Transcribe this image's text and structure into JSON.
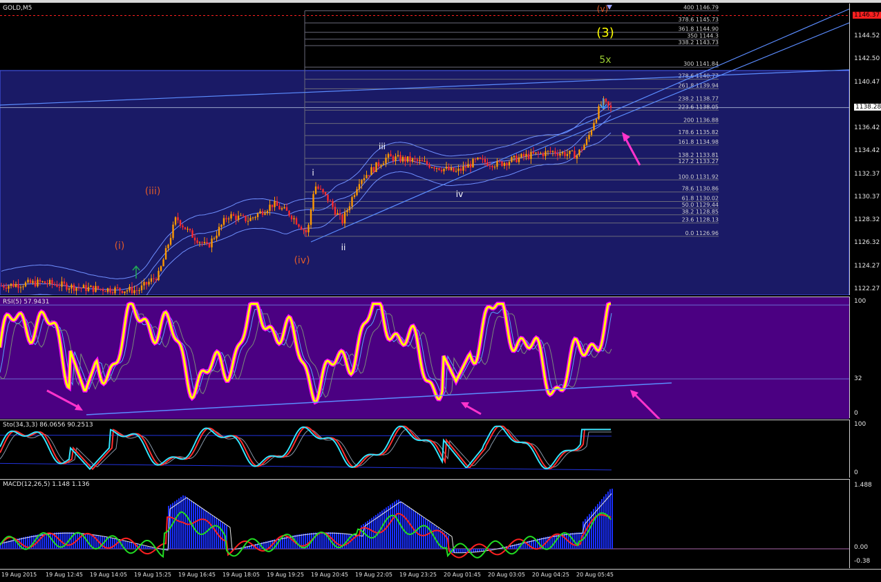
{
  "chart_title": "GOLD,M5",
  "price_axis": {
    "labels": [
      "1146.37",
      "1144.52",
      "1142.50",
      "1140.47",
      "1138.28",
      "1136.42",
      "1134.42",
      "1132.37",
      "1130.37",
      "1128.32",
      "1126.32",
      "1124.27",
      "1122.27"
    ],
    "current_price": "1138.28",
    "alert_price": "1146.37"
  },
  "fibonacci_levels": [
    {
      "label": "400 1146.79"
    },
    {
      "label": "378.6 1145.73"
    },
    {
      "label": "361.8 1144.90"
    },
    {
      "label": "350 1144.3"
    },
    {
      "label": "338.2 1143.73"
    },
    {
      "label": "300 1141.84"
    },
    {
      "label": "278.6 1140.77"
    },
    {
      "label": "261.8 1139.94"
    },
    {
      "label": "238.2 1138.77"
    },
    {
      "label": "223.6 1138.05"
    },
    {
      "label": "200 1136.88"
    },
    {
      "label": "178.6 1135.82"
    },
    {
      "label": "161.8 1134.98"
    },
    {
      "label": "138.2 1133.81"
    },
    {
      "label": "127.2 1133.27"
    },
    {
      "label": "100.0 1131.92"
    },
    {
      "label": "78.6 1130.86"
    },
    {
      "label": "61.8 1130.02"
    },
    {
      "label": "50.0 1129.44"
    },
    {
      "label": "38.2 1128.85"
    },
    {
      "label": "23.6 1128.13"
    },
    {
      "label": "0.0 1126.96"
    }
  ],
  "wave_labels": {
    "w_i_paren": "(i)",
    "w_iii_paren": "(iii)",
    "w_iv_paren": "(iv)",
    "w_v_paren": "(v)",
    "w_3": "(3)",
    "w_5x": "5x",
    "w_i": "i",
    "w_ii": "ii",
    "w_iii": "iii",
    "w_iv": "iv"
  },
  "rsi": {
    "label": "RSI(5) 57.9431",
    "axis": [
      "100",
      "32",
      "0"
    ]
  },
  "stochastic": {
    "label": "Sto(34,3,3) 86.0656 90.2513",
    "axis": [
      "100",
      "0"
    ]
  },
  "macd": {
    "label": "MACD(12,26,5) 1.148 1.136",
    "axis": [
      "1.488",
      "0.00",
      "-0.38"
    ]
  },
  "time_axis": [
    "19 Aug 2015",
    "19 Aug 12:45",
    "19 Aug 14:05",
    "19 Aug 15:25",
    "19 Aug 16:45",
    "19 Aug 18:05",
    "19 Aug 19:25",
    "19 Aug 20:45",
    "19 Aug 22:05",
    "19 Aug 23:25",
    "20 Aug 01:45",
    "20 Aug 03:05",
    "20 Aug 04:25",
    "20 Aug 05:45"
  ],
  "colors": {
    "price_panel_bg": "#1a1a66",
    "rsi_panel_bg": "#4b0082",
    "rsi_line": "#ffff00",
    "rsi_shadow": "#ff00ff",
    "bull_candle": "#ff9900",
    "bear_candle": "#ff2a2a",
    "bands": "#6f8fff",
    "trendline": "#5b8cff",
    "arrow": "#ff33cc",
    "alert_line": "#ff2020",
    "wave_major": "#ffff00",
    "wave_minor": "#e05a2a",
    "macd_hist": "#1a2fff",
    "macd_signal": "#ff2020",
    "macd_green": "#22dd22",
    "sto_main": "#33e5ff",
    "sto_signal": "#ff3030"
  }
}
